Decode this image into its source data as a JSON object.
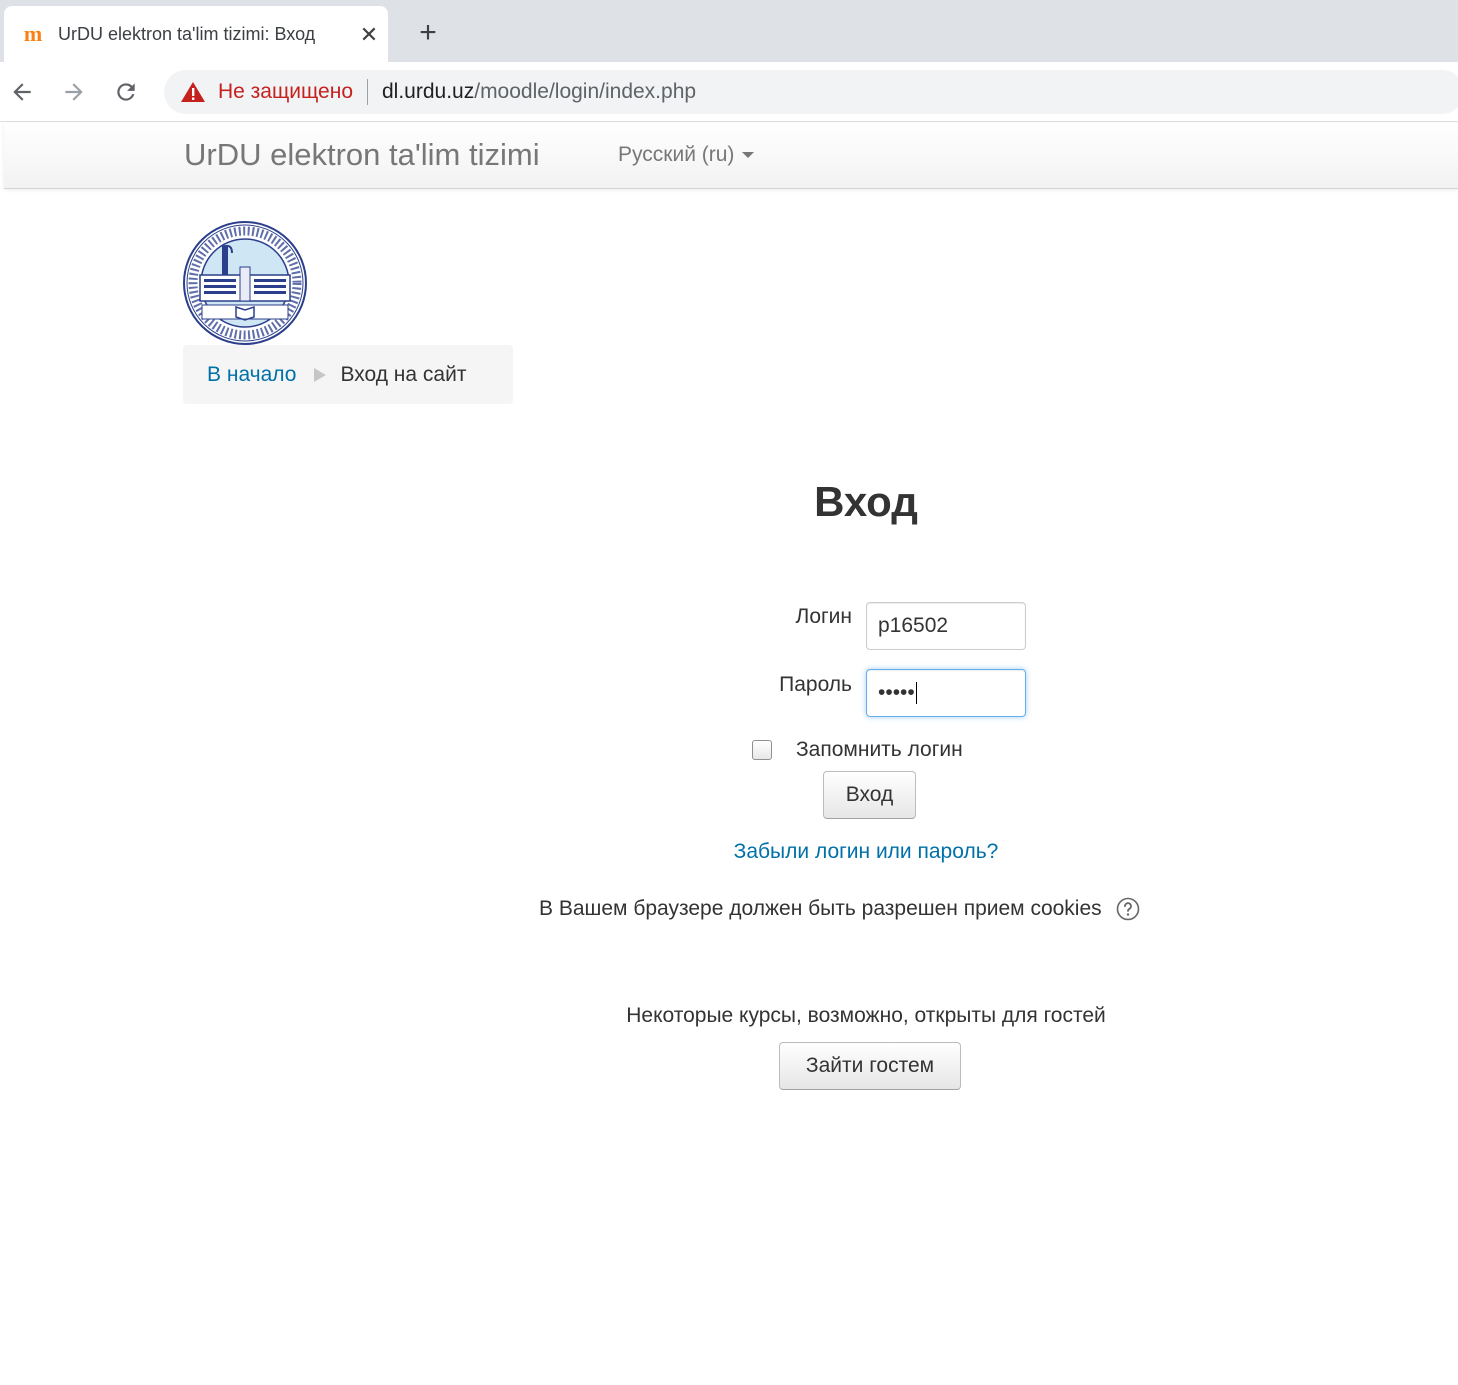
{
  "browser": {
    "tab_title": "UrDU elektron ta'lim tizimi: Вход",
    "favicon_glyph": "m",
    "close_glyph": "✕",
    "new_tab_glyph": "+",
    "security_label": "Не защищено",
    "url_host": "dl.urdu.uz",
    "url_path": "/moodle/login/index.php",
    "icons": [
      "moodle-favicon",
      "close-icon",
      "plus-icon",
      "arrow-left-icon",
      "arrow-right-icon",
      "reload-icon",
      "warning-icon"
    ]
  },
  "navbar": {
    "brand": "UrDU elektron ta'lim tizimi",
    "language": "Русский (ru)"
  },
  "breadcrumb": {
    "home": "В начало",
    "current": "Вход на сайт"
  },
  "login": {
    "title": "Вход",
    "username_label": "Логин",
    "username_value": "p16502",
    "password_label": "Пароль",
    "password_mask": "•••••",
    "remember_label": "Запомнить логин",
    "submit_label": "Вход",
    "forgot_link": "Забыли логин или пароль?",
    "cookies_notice": "В Вашем браузере должен быть разрешен прием cookies",
    "guest_notice": "Некоторые курсы, возможно, открыты для гостей",
    "guest_button": "Зайти гостем"
  },
  "colors": {
    "link": "#0070a8",
    "warning": "#c5221f",
    "highlight": "#f4ff00",
    "moodle_orange": "#f98012"
  }
}
